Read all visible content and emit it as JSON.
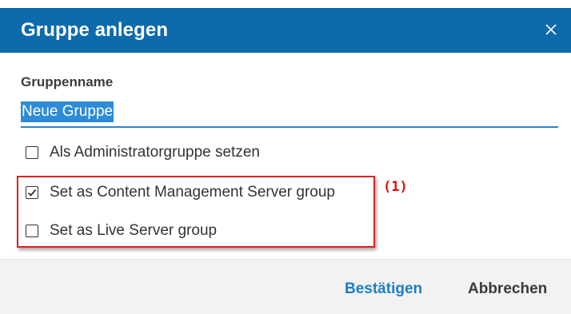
{
  "dialog": {
    "title": "Gruppe anlegen",
    "close_icon": "close-icon",
    "accent_color": "#0d6aab"
  },
  "form": {
    "name_label": "Gruppenname",
    "name_value": "Neue Gruppe",
    "checkboxes": [
      {
        "label": "Als Administratorgruppe setzen",
        "checked": false
      },
      {
        "label": "Set as Content Management Server group",
        "checked": true
      },
      {
        "label": "Set as Live Server group",
        "checked": false
      }
    ]
  },
  "annotation": {
    "label": "(1)",
    "color": "#e02020"
  },
  "footer": {
    "confirm_label": "Bestätigen",
    "cancel_label": "Abbrechen"
  }
}
